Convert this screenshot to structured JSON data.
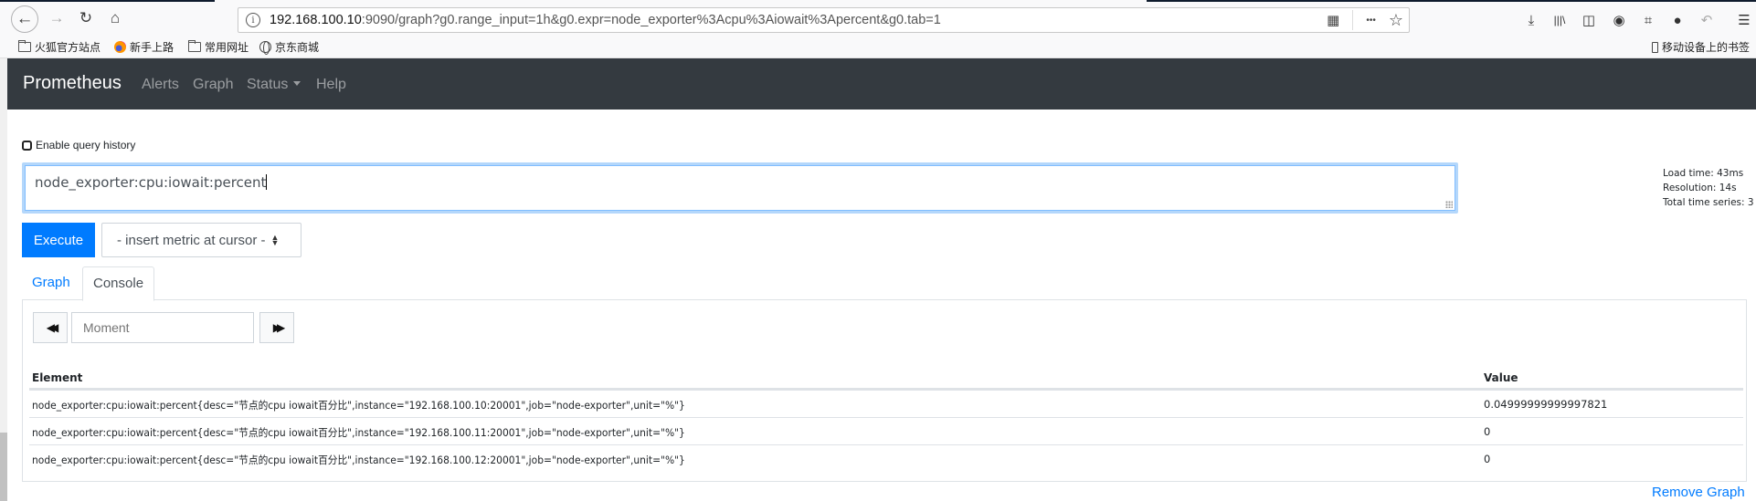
{
  "browser": {
    "url_host": "192.168.100.10",
    "url_rest": ":9090/graph?g0.range_input=1h&g0.expr=node_exporter%3Acpu%3Aiowait%3Apercent&g0.tab=1",
    "icons": {
      "back": "←",
      "forward": "→",
      "reload": "↻",
      "home": "⌂",
      "info": "i",
      "qr": "▦",
      "more": "•••",
      "star": "☆",
      "download": "⤓",
      "library": "|||\\",
      "sidebar": "◫",
      "account": "◉",
      "screenshot": "⌗",
      "chat": "●",
      "undo": "↶",
      "menu": "☰"
    },
    "bookmarks": [
      {
        "label": "火狐官方站点",
        "icon": "folder-icon"
      },
      {
        "label": "新手上路",
        "icon": "firefox-icon"
      },
      {
        "label": "常用网址",
        "icon": "folder-icon"
      },
      {
        "label": "京东商城",
        "icon": "globe-icon"
      }
    ],
    "mobile_bookmarks": "移动设备上的书签"
  },
  "navbar": {
    "brand": "Prometheus",
    "links": [
      "Alerts",
      "Graph",
      "Status",
      "Help"
    ]
  },
  "query": {
    "history_label": "Enable query history",
    "history_enabled": false,
    "expression": "node_exporter:cpu:iowait:percent",
    "execute_label": "Execute",
    "metric_select": "- insert metric at cursor -"
  },
  "stats": {
    "load_time": "Load time: 43ms",
    "resolution": "Resolution: 14s",
    "total_series": "Total time series: 3"
  },
  "tabs": {
    "graph": "Graph",
    "console": "Console",
    "active": "Console"
  },
  "console": {
    "moment_placeholder": "Moment",
    "prev_icon": "◀◀",
    "next_icon": "▶▶",
    "columns": [
      "Element",
      "Value"
    ],
    "rows": [
      {
        "element": "node_exporter:cpu:iowait:percent{desc=\"节点的cpu iowait百分比\",instance=\"192.168.100.10:20001\",job=\"node-exporter\",unit=\"%\"}",
        "value": "0.04999999999997821"
      },
      {
        "element": "node_exporter:cpu:iowait:percent{desc=\"节点的cpu iowait百分比\",instance=\"192.168.100.11:20001\",job=\"node-exporter\",unit=\"%\"}",
        "value": "0"
      },
      {
        "element": "node_exporter:cpu:iowait:percent{desc=\"节点的cpu iowait百分比\",instance=\"192.168.100.12:20001\",job=\"node-exporter\",unit=\"%\"}",
        "value": "0"
      }
    ]
  },
  "remove_graph": "Remove Graph"
}
